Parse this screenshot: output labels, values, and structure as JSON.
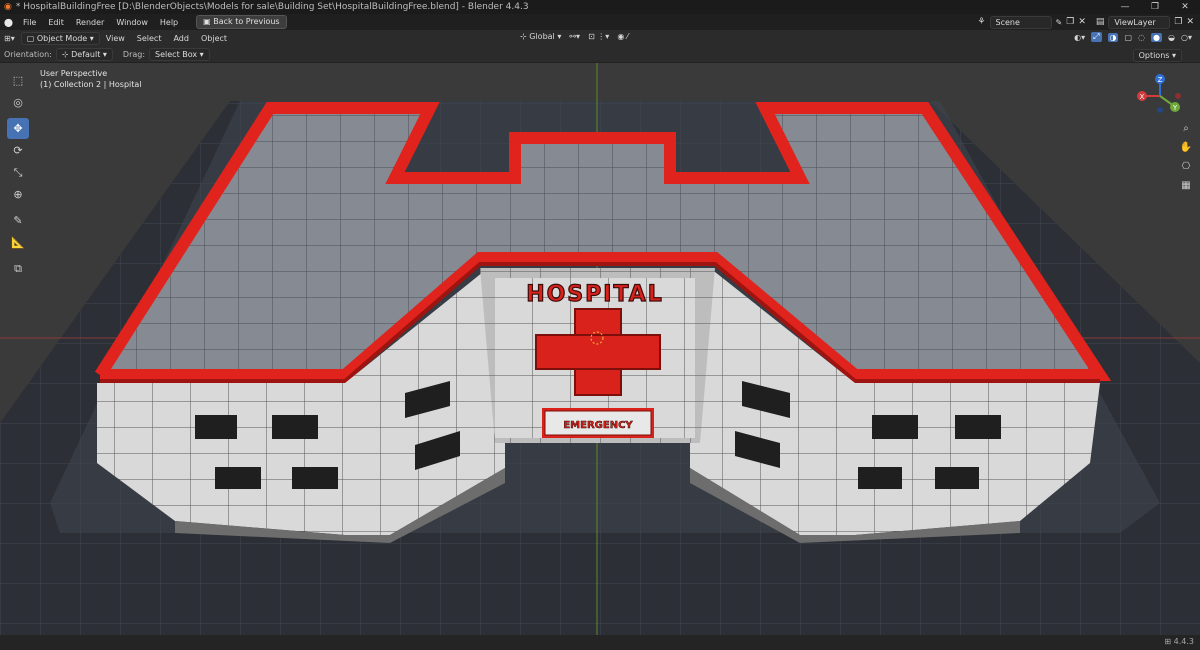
{
  "window": {
    "title": "* HospitalBuildingFree [D:\\BlenderObjects\\Models for sale\\Building Set\\HospitalBuildingFree.blend] - Blender 4.4.3",
    "controls": [
      "—",
      "❐",
      "✕"
    ]
  },
  "menubar": {
    "items": [
      "File",
      "Edit",
      "Render",
      "Window",
      "Help"
    ],
    "back_label": "Back to Previous",
    "scene": "Scene",
    "view_layer": "ViewLayer"
  },
  "header": {
    "mode": "Object Mode",
    "menus": [
      "View",
      "Select",
      "Add",
      "Object"
    ],
    "transform_orientation": "Global"
  },
  "tool_header": {
    "orientation_label": "Orientation:",
    "orientation_value": "Default",
    "drag_label": "Drag:",
    "drag_value": "Select Box",
    "options_label": "Options"
  },
  "viewport": {
    "perspective": "User Perspective",
    "collection": "(1) Collection 2 | Hospital",
    "sign_text": "HOSPITAL",
    "emergency_text": "EMERGENCY",
    "gizmo": {
      "x": "X",
      "y": "Y",
      "z": "Z"
    }
  },
  "statusbar": {
    "version": "4.4.3"
  },
  "colors": {
    "accent": "#4772b3",
    "trim_red": "#e0231c",
    "wall": "#d8d8d8",
    "roof": "#8a8f98"
  },
  "icons": {
    "toolbar": [
      "select-box-icon",
      "cursor-icon",
      "move-icon",
      "rotate-icon",
      "scale-icon",
      "transform-icon",
      "annotate-icon",
      "measure-icon",
      "add-cube-icon"
    ],
    "nav": [
      "zoom-icon",
      "pan-hand-icon",
      "camera-icon",
      "grid-icon"
    ]
  }
}
